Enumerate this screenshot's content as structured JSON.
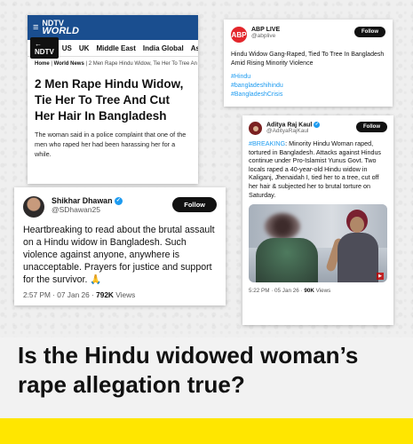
{
  "ndtv": {
    "logo_line1": "NDTV",
    "logo_line2": "WORLD",
    "nav_button": "NDTV",
    "nav_items": [
      "US",
      "UK",
      "Middle East",
      "India Global",
      "Asia"
    ],
    "crumb_home": "Home",
    "crumb_section": "World News",
    "crumb_title": "2 Men Rape Hindu Widow, Tie Her To Tree An",
    "headline": "2 Men Rape Hindu Widow, Tie Her To Tree And Cut Her Hair In Bangladesh",
    "body": "The woman said in a police complaint that one of the men who raped her had been harassing her for a while."
  },
  "abp": {
    "avatar_text": "ABP",
    "name": "ABP LIVE",
    "handle": "@abplive",
    "follow_label": "Follow",
    "text": "Hindu Widow Gang-Raped, Tied To Tree In Bangladesh Amid Rising Minority Violence",
    "tag1": "#Hindu",
    "tag2": "#bangladeshihindu",
    "tag3": "#BangladeshCrisis"
  },
  "aditya": {
    "name": "Aditya Raj Kaul",
    "handle": "@AdityaRajKaul",
    "follow_label": "Follow",
    "hashtag": "#BREAKING",
    "text": ": Minority Hindu Woman raped, tortured in Bangladesh. Attacks against Hindus continue under Pro-Islamist Yunus Govt. Two locals raped a 40-year-old Hindu widow in Kaliganj, Jhenaidah I, tied her to a tree, cut off her hair & subjected her to brutal torture on Saturday.",
    "time": "5:22 PM · 05 Jan 26 · ",
    "views": "90K",
    "views_label": " Views"
  },
  "shikhar": {
    "name": "Shikhar Dhawan",
    "handle": "@SDhawan25",
    "follow_label": "Follow",
    "text": "Heartbreaking to read about the brutal assault on a Hindu widow in Bangladesh. Such violence against anyone, anywhere is unacceptable. Prayers for justice and support for the survivor. 🙏",
    "time": "2:57 PM · 07 Jan 26 · ",
    "views": "792K",
    "views_label": " Views"
  },
  "question": "Is the Hindu widowed woman’s rape allegation true?",
  "colors": {
    "accent_yellow": "#ffe600",
    "ndtv_blue": "#1a4e8f",
    "twitter_blue": "#1d9bf0",
    "abp_red": "#e3262b"
  }
}
